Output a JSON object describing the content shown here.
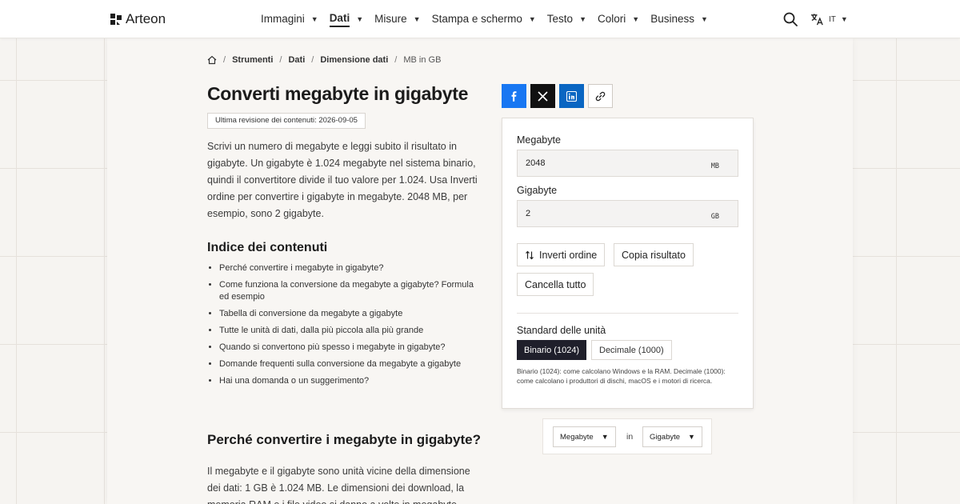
{
  "brand": {
    "name": "Arteon"
  },
  "nav": {
    "items": [
      {
        "label": "Immagini",
        "active": false
      },
      {
        "label": "Dati",
        "active": true
      },
      {
        "label": "Misure",
        "active": false
      },
      {
        "label": "Stampa e schermo",
        "active": false
      },
      {
        "label": "Testo",
        "active": false
      },
      {
        "label": "Colori",
        "active": false
      },
      {
        "label": "Business",
        "active": false
      }
    ],
    "language": "IT"
  },
  "breadcrumb": {
    "sep": "/",
    "items": [
      "Strumenti",
      "Dati",
      "Dimensione dati"
    ],
    "current": "MB in GB"
  },
  "page": {
    "title": "Converti megabyte in gigabyte",
    "revision": "Ultima revisione dei contenuti: 2026-09-05",
    "intro": "Scrivi un numero di megabyte e leggi subito il risultato in gigabyte. Un gigabyte è 1.024 megabyte nel sistema binario, quindi il convertitore divide il tuo valore per 1.024. Usa Inverti ordine per convertire i gigabyte in megabyte. 2048 MB, per esempio, sono 2 gigabyte."
  },
  "toc": {
    "title": "Indice dei contenuti",
    "items": [
      "Perché convertire i megabyte in gigabyte?",
      "Come funziona la conversione da megabyte a gigabyte? Formula ed esempio",
      "Tabella di conversione da megabyte a gigabyte",
      "Tutte le unità di dati, dalla più piccola alla più grande",
      "Quando si convertono più spesso i megabyte in gigabyte?",
      "Domande frequenti sulla conversione da megabyte a gigabyte",
      "Hai una domanda o un suggerimento?"
    ]
  },
  "section": {
    "title": "Perché convertire i megabyte in gigabyte?",
    "text": "Il megabyte e il gigabyte sono unità vicine della dimensione dei dati: 1 GB è 1.024 MB. Le dimensioni dei download, la memoria RAM e i file video si danno a volte in megabyte"
  },
  "share": [
    "facebook-icon",
    "x-icon",
    "linkedin-icon",
    "link-icon"
  ],
  "converter": {
    "from": {
      "label": "Megabyte",
      "value": "2048",
      "unit": "MB"
    },
    "to": {
      "label": "Gigabyte",
      "value": "2",
      "unit": "GB"
    },
    "buttons": {
      "swap": "Inverti ordine",
      "copy": "Copia risultato",
      "clear": "Cancella tutto"
    },
    "standard": {
      "label": "Standard delle unità",
      "binary": "Binario (1024)",
      "decimal": "Decimale (1000)",
      "selected": "binary",
      "note": "Binario (1024): come calcolano Windows e la RAM. Decimale (1000): come calcolano i produttori di dischi, macOS e i motori di ricerca."
    }
  },
  "unit_bar": {
    "from": "Megabyte",
    "connector": "in",
    "to": "Gigabyte"
  },
  "colors": {
    "accent_dark": "#1f1f2b",
    "facebook": "#1877f2",
    "x": "#111111",
    "linkedin": "#0a66c2"
  }
}
